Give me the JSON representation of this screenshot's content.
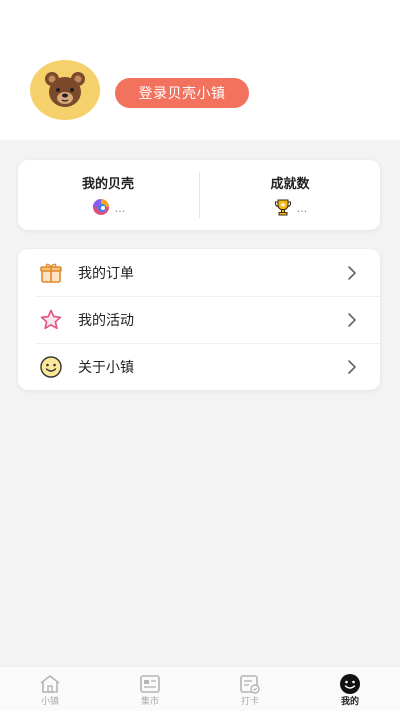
{
  "header": {
    "avatar": "bear-avatar",
    "login_button": "登录贝壳小镇"
  },
  "stats": {
    "shells": {
      "label": "我的贝壳",
      "value": "...",
      "icon": "shell-icon"
    },
    "achievements": {
      "label": "成就数",
      "value": "...",
      "icon": "trophy-icon"
    }
  },
  "menu": {
    "items": [
      {
        "label": "我的订单",
        "icon": "gift-box-icon"
      },
      {
        "label": "我的活动",
        "icon": "star-icon"
      },
      {
        "label": "关于小镇",
        "icon": "smiley-icon"
      }
    ]
  },
  "tabbar": {
    "tabs": [
      {
        "label": "小镇",
        "icon": "home-icon",
        "active": false
      },
      {
        "label": "集市",
        "icon": "market-icon",
        "active": false
      },
      {
        "label": "打卡",
        "icon": "checkin-icon",
        "active": false
      },
      {
        "label": "我的",
        "icon": "profile-icon",
        "active": true
      }
    ]
  },
  "colors": {
    "accent": "#f2725e",
    "avatar_bg": "#f6d16b",
    "page_bg": "#f3f3f3"
  }
}
